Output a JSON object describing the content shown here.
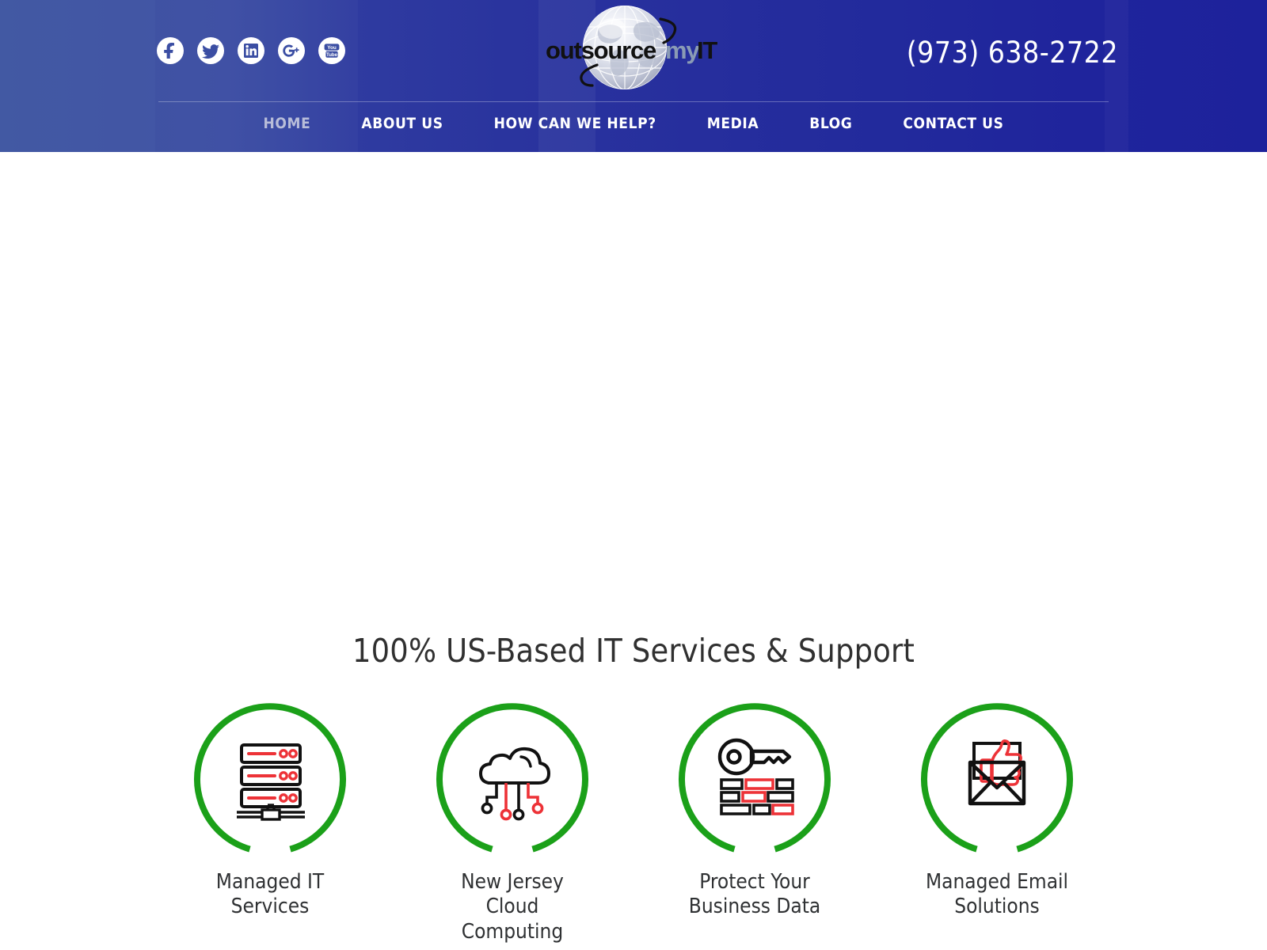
{
  "header": {
    "phone": "(973) 638-2722",
    "logo": {
      "word1": "outsource",
      "word2": "my",
      "word3": "IT",
      "word1_color": "#111111",
      "word2_color": "#8a9bb5",
      "word3_color": "#111111"
    },
    "social": [
      {
        "name": "facebook-icon",
        "label": "Facebook"
      },
      {
        "name": "twitter-icon",
        "label": "Twitter"
      },
      {
        "name": "linkedin-icon",
        "label": "LinkedIn"
      },
      {
        "name": "googleplus-icon",
        "label": "Google Plus"
      },
      {
        "name": "youtube-icon",
        "label": "YouTube"
      }
    ],
    "nav": [
      {
        "label": "HOME",
        "active": true
      },
      {
        "label": "ABOUT US",
        "active": false
      },
      {
        "label": "HOW CAN WE HELP?",
        "active": false
      },
      {
        "label": "MEDIA",
        "active": false
      },
      {
        "label": "BLOG",
        "active": false
      },
      {
        "label": "CONTACT US",
        "active": false
      }
    ],
    "gradient_start": "#3a529f",
    "gradient_end": "#1d229b"
  },
  "services": {
    "heading": "100% US-Based IT Services & Support",
    "ring_color": "#1ba019",
    "accent_color": "#ed3237",
    "items": [
      {
        "icon": "server-rack-icon",
        "label": "Managed IT\nServices"
      },
      {
        "icon": "cloud-network-icon",
        "label": "New Jersey\nCloud Computing"
      },
      {
        "icon": "key-data-icon",
        "label": "Protect Your\nBusiness Data"
      },
      {
        "icon": "envelope-thumbsup-icon",
        "label": "Managed Email\nSolutions"
      }
    ]
  }
}
